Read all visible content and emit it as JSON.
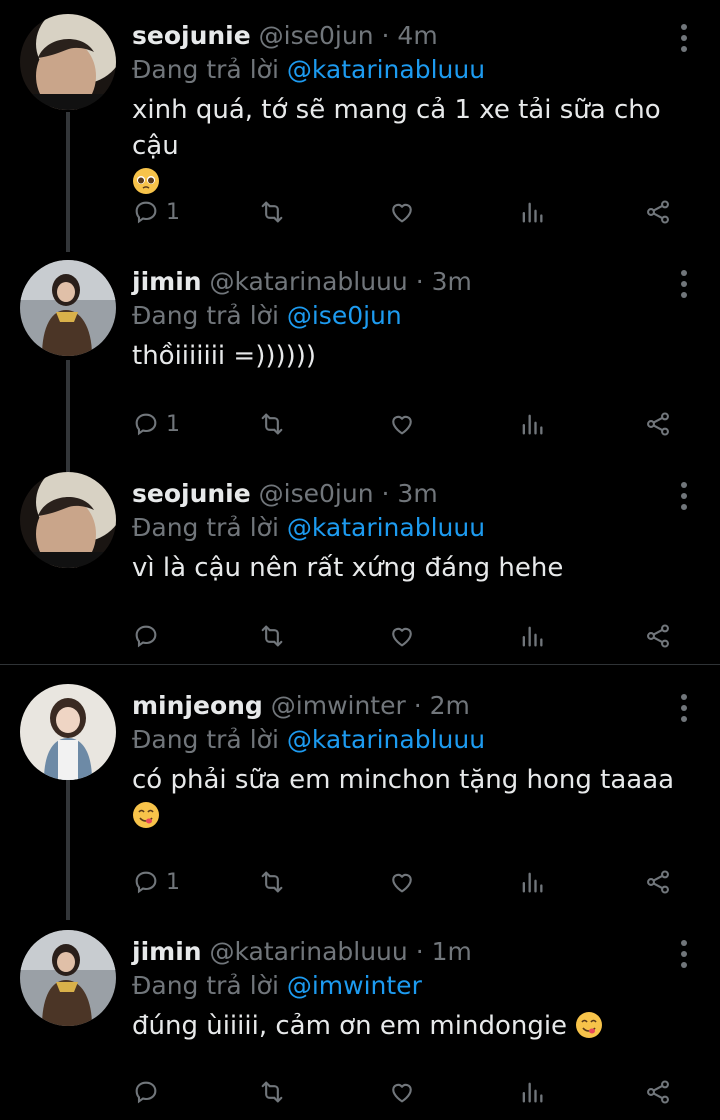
{
  "colors": {
    "background": "#000000",
    "text": "#e7e9ea",
    "muted": "#71767b",
    "link": "#1d9bf0"
  },
  "icons": [
    "reply-icon",
    "retweet-icon",
    "like-icon",
    "views-icon",
    "share-icon",
    "more-icon"
  ],
  "tweets": [
    {
      "name": "seojunie",
      "handle": "@ise0jun",
      "time": "· 4m",
      "replying_prefix": "Đang trả lời",
      "replying_to": "@katarinabluuu",
      "text": "xinh quá, tớ sẽ mang cả 1 xe tải sữa cho cậu",
      "emoji": "pleading-face-emoji",
      "reply_count": "1"
    },
    {
      "name": "jimin",
      "handle": "@katarinabluuu",
      "time": "· 3m",
      "replying_prefix": "Đang trả lời",
      "replying_to": "@ise0jun",
      "text": "thồiiiiiii =))))))",
      "emoji": "",
      "reply_count": "1"
    },
    {
      "name": "seojunie",
      "handle": "@ise0jun",
      "time": "· 3m",
      "replying_prefix": "Đang trả lời",
      "replying_to": "@katarinabluuu",
      "text": "vì là cậu nên rất xứng đáng hehe",
      "emoji": "",
      "reply_count": ""
    },
    {
      "name": "minjeong",
      "handle": "@imwinter",
      "time": "· 2m",
      "replying_prefix": "Đang trả lời",
      "replying_to": "@katarinabluuu",
      "text": "có phải sữa em minchon tặng hong taaaa",
      "emoji": "yum-face-emoji",
      "reply_count": "1"
    },
    {
      "name": "jimin",
      "handle": "@katarinabluuu",
      "time": "· 1m",
      "replying_prefix": "Đang trả lời",
      "replying_to": "@imwinter",
      "text": "đúng ùiiiii, cảm ơn em mindongie",
      "emoji": "yum-face-emoji",
      "reply_count": ""
    }
  ]
}
